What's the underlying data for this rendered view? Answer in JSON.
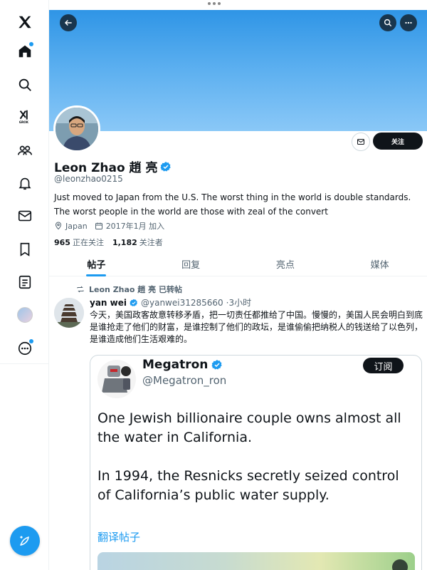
{
  "profile": {
    "display_name": "Leon Zhao 趙 亮",
    "handle": "@leonzhao0215",
    "bio": "Just moved to Japan from the U.S. The worst thing in the world is double standards. The worst people in the world are those with zeal of the convert",
    "location": "Japan",
    "joined": "2017年1月 加入",
    "following_count": "965",
    "following_label": "正在关注",
    "followers_count": "1,182",
    "followers_label": "关注者",
    "follow_button": "关注"
  },
  "tabs": [
    {
      "label": "帖子",
      "active": true
    },
    {
      "label": "回复",
      "active": false
    },
    {
      "label": "亮点",
      "active": false
    },
    {
      "label": "媒体",
      "active": false
    }
  ],
  "post": {
    "repost_label": "Leon Zhao 趙 亮 已转帖",
    "author_name": "yan wei",
    "author_handle": "@yanwei31285660",
    "time": "·3小时",
    "text": "今天，美国政客故意转移矛盾，把一切责任都推给了中国。慢慢的，美国人民会明白到底是谁抢走了他们的财富，是谁控制了他们的政坛，是谁偷偷把纳税人的钱送给了以色列，是谁造成他们生活艰难的。",
    "quote": {
      "name": "Megatron",
      "handle": "@Megatron_ron",
      "subscribe_label": "订阅",
      "paragraph1": "One Jewish billionaire couple owns almost all the water in California.",
      "paragraph2": "In 1994, the Resnicks secretly seized control of California’s public water supply.",
      "translate_label": "翻译帖子"
    }
  },
  "icons": {
    "sidebar": [
      "x-logo-icon",
      "home-icon",
      "search-icon",
      "grok-icon",
      "communities-icon",
      "notifications-icon",
      "messages-icon",
      "bookmarks-icon",
      "lists-icon",
      "profile-avatar",
      "more-icon"
    ],
    "compose": "compose-icon"
  },
  "colors": {
    "accent": "#1d9bf0",
    "banner": "#3d9fea",
    "text": "#0f1419",
    "secondary": "#536471"
  }
}
